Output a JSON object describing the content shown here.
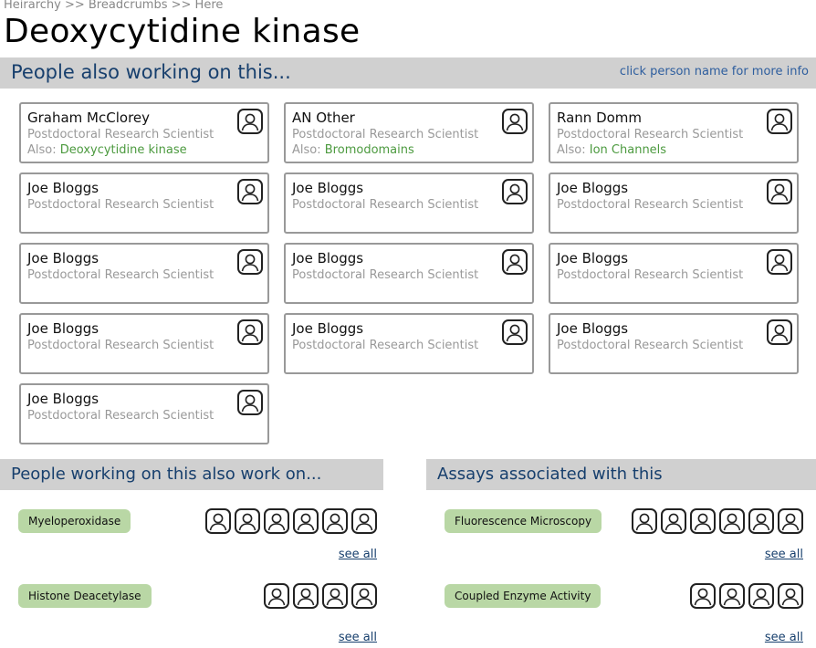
{
  "breadcrumb": "Heirarchy >> Breadcrumbs >> Here",
  "page_title": "Deoxycytidine kinase",
  "people_section": {
    "title": "People also working on this...",
    "hint": "click person name for more info",
    "people": [
      {
        "name": "Graham McClorey",
        "role": "Postdoctoral Research Scientist",
        "also_label": "Also:",
        "also_topic": "Deoxycytidine kinase"
      },
      {
        "name": "AN Other",
        "role": "Postdoctoral Research Scientist",
        "also_label": "Also:",
        "also_topic": "Bromodomains"
      },
      {
        "name": "Rann Domm",
        "role": "Postdoctoral Research Scientist",
        "also_label": "Also:",
        "also_topic": "Ion Channels"
      },
      {
        "name": "Joe Bloggs",
        "role": "Postdoctoral Research Scientist"
      },
      {
        "name": "Joe Bloggs",
        "role": "Postdoctoral Research Scientist"
      },
      {
        "name": "Joe Bloggs",
        "role": "Postdoctoral Research Scientist"
      },
      {
        "name": "Joe Bloggs",
        "role": "Postdoctoral Research Scientist"
      },
      {
        "name": "Joe Bloggs",
        "role": "Postdoctoral Research Scientist"
      },
      {
        "name": "Joe Bloggs",
        "role": "Postdoctoral Research Scientist"
      },
      {
        "name": "Joe Bloggs",
        "role": "Postdoctoral Research Scientist"
      },
      {
        "name": "Joe Bloggs",
        "role": "Postdoctoral Research Scientist"
      },
      {
        "name": "Joe Bloggs",
        "role": "Postdoctoral Research Scientist"
      },
      {
        "name": "Joe Bloggs",
        "role": "Postdoctoral Research Scientist"
      }
    ]
  },
  "also_work_section": {
    "title": "People working on this also work on...",
    "items": [
      {
        "tag": "Myeloperoxidase",
        "avatar_count": 6,
        "see_all": "see all"
      },
      {
        "tag": "Histone Deacetylase",
        "avatar_count": 4,
        "see_all": "see all"
      }
    ]
  },
  "assays_section": {
    "title": "Assays associated with this",
    "items": [
      {
        "tag": "Fluorescence Microscopy",
        "avatar_count": 6,
        "see_all": "see all"
      },
      {
        "tag": "Coupled Enzyme Activity",
        "avatar_count": 4,
        "see_all": "see all"
      }
    ]
  },
  "icons": {
    "person": "person-icon"
  },
  "colors": {
    "section_bar": "#d0d0d0",
    "heading_text": "#173f6d",
    "tag_bg": "#b9d7a5",
    "topic_text": "#4c9a3f",
    "muted_text": "#999999"
  }
}
